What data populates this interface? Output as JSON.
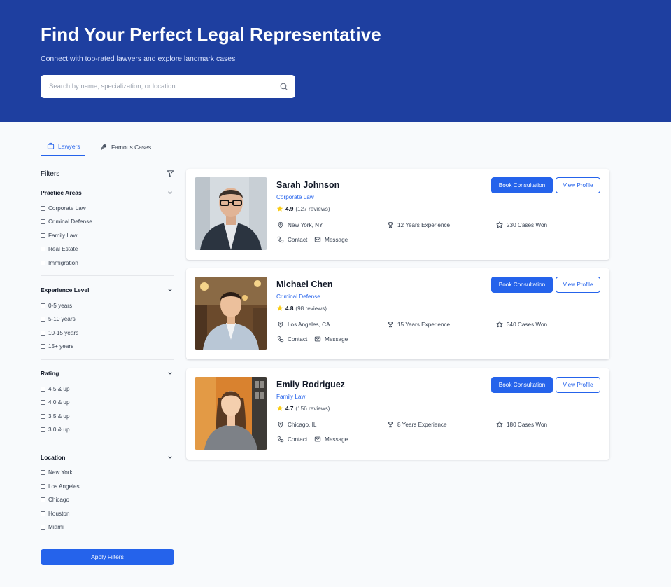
{
  "hero": {
    "title": "Find Your Perfect Legal Representative",
    "subtitle": "Connect with top-rated lawyers and explore landmark cases",
    "search_placeholder": "Search by name, specialization, or location...",
    "bg_color": "#1e3fa0"
  },
  "tabs": [
    {
      "label": "Lawyers",
      "icon": "briefcase-icon",
      "active": true
    },
    {
      "label": "Famous Cases",
      "icon": "gavel-icon",
      "active": false
    }
  ],
  "filters": {
    "title": "Filters",
    "apply_label": "Apply Filters",
    "sections": [
      {
        "title": "Practice Areas",
        "options": [
          "Corporate Law",
          "Criminal Defense",
          "Family Law",
          "Real Estate",
          "Immigration"
        ]
      },
      {
        "title": "Experience Level",
        "options": [
          "0-5 years",
          "5-10 years",
          "10-15 years",
          "15+ years"
        ]
      },
      {
        "title": "Rating",
        "options": [
          "4.5 & up",
          "4.0 & up",
          "3.5 & up",
          "3.0 & up"
        ]
      },
      {
        "title": "Location",
        "options": [
          "New York",
          "Los Angeles",
          "Chicago",
          "Houston",
          "Miami"
        ]
      }
    ]
  },
  "lawyers": [
    {
      "name": "Sarah Johnson",
      "specialization": "Corporate Law",
      "rating": "4.9",
      "reviews": "(127 reviews)",
      "location": "New York, NY",
      "experience": "12 Years Experience",
      "cases_won": "230 Cases Won"
    },
    {
      "name": "Michael Chen",
      "specialization": "Criminal Defense",
      "rating": "4.8",
      "reviews": "(98 reviews)",
      "location": "Los Angeles, CA",
      "experience": "15 Years Experience",
      "cases_won": "340 Cases Won"
    },
    {
      "name": "Emily Rodriguez",
      "specialization": "Family Law",
      "rating": "4.7",
      "reviews": "(156 reviews)",
      "location": "Chicago, IL",
      "experience": "8 Years Experience",
      "cases_won": "180 Cases Won"
    }
  ],
  "card_actions": {
    "book_label": "Book Consultation",
    "view_label": "View Profile",
    "contact_label": "Contact",
    "message_label": "Message"
  },
  "colors": {
    "accent": "#2563eb",
    "star": "#facc15",
    "page_bg": "#f8fafc"
  }
}
